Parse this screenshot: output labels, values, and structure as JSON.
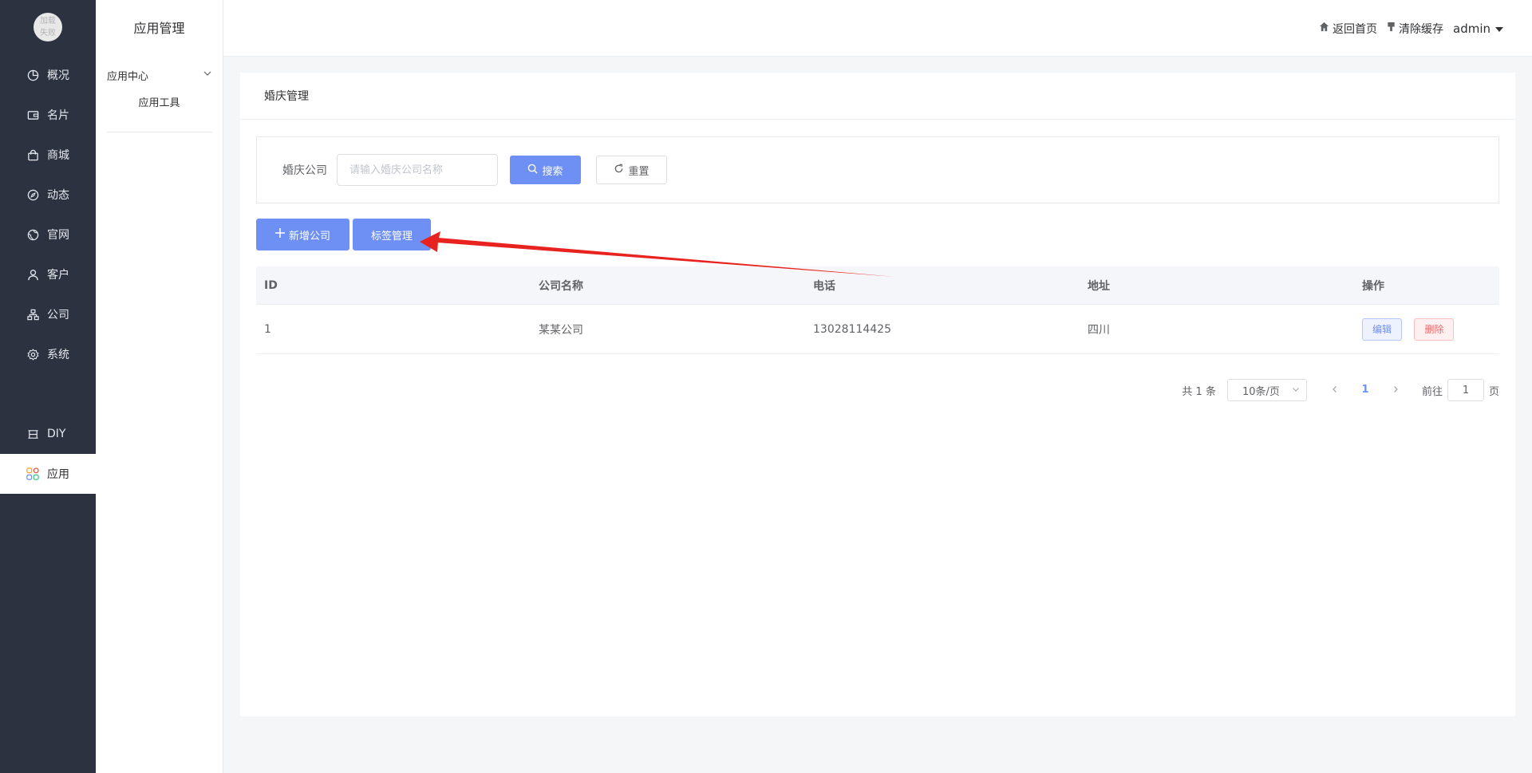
{
  "logo": {
    "line1": "加载",
    "line2": "失败"
  },
  "nav": [
    {
      "label": "概况",
      "icon": "pie-chart-icon"
    },
    {
      "label": "名片",
      "icon": "wallet-icon"
    },
    {
      "label": "商城",
      "icon": "shopping-bag-icon"
    },
    {
      "label": "动态",
      "icon": "compass-icon"
    },
    {
      "label": "官网",
      "icon": "globe-icon"
    },
    {
      "label": "客户",
      "icon": "user-icon"
    },
    {
      "label": "公司",
      "icon": "org-chart-icon"
    },
    {
      "label": "系统",
      "icon": "gear-icon"
    },
    {
      "label": "DIY",
      "icon": "layout-icon"
    },
    {
      "label": "应用",
      "icon": "apps-grid-icon",
      "active": true
    }
  ],
  "subside": {
    "title": "应用管理",
    "group": "应用中心",
    "item": "应用工具"
  },
  "header": {
    "home": "返回首页",
    "clear_cache": "清除缓存",
    "user": "admin"
  },
  "page": {
    "title": "婚庆管理",
    "filter": {
      "label": "婚庆公司",
      "placeholder": "请输入婚庆公司名称",
      "value": "",
      "search": "搜索",
      "reset": "重置"
    },
    "actions": {
      "add": "新增公司",
      "tags": "标签管理"
    },
    "table": {
      "columns": [
        "ID",
        "公司名称",
        "电话",
        "地址",
        "操作"
      ],
      "rows": [
        {
          "id": "1",
          "name": "某某公司",
          "phone": "13028114425",
          "address": "四川",
          "edit": "编辑",
          "delete": "删除"
        }
      ]
    },
    "pagination": {
      "total": "共 1 条",
      "page_size": "10条/页",
      "current": "1",
      "goto_prefix": "前往",
      "goto_value": "1",
      "goto_suffix": "页"
    }
  },
  "colors": {
    "sidebar": "#2c3240",
    "primary": "#6e8ff3",
    "danger": "#f06969",
    "annotation_arrow": "#e8231f"
  }
}
